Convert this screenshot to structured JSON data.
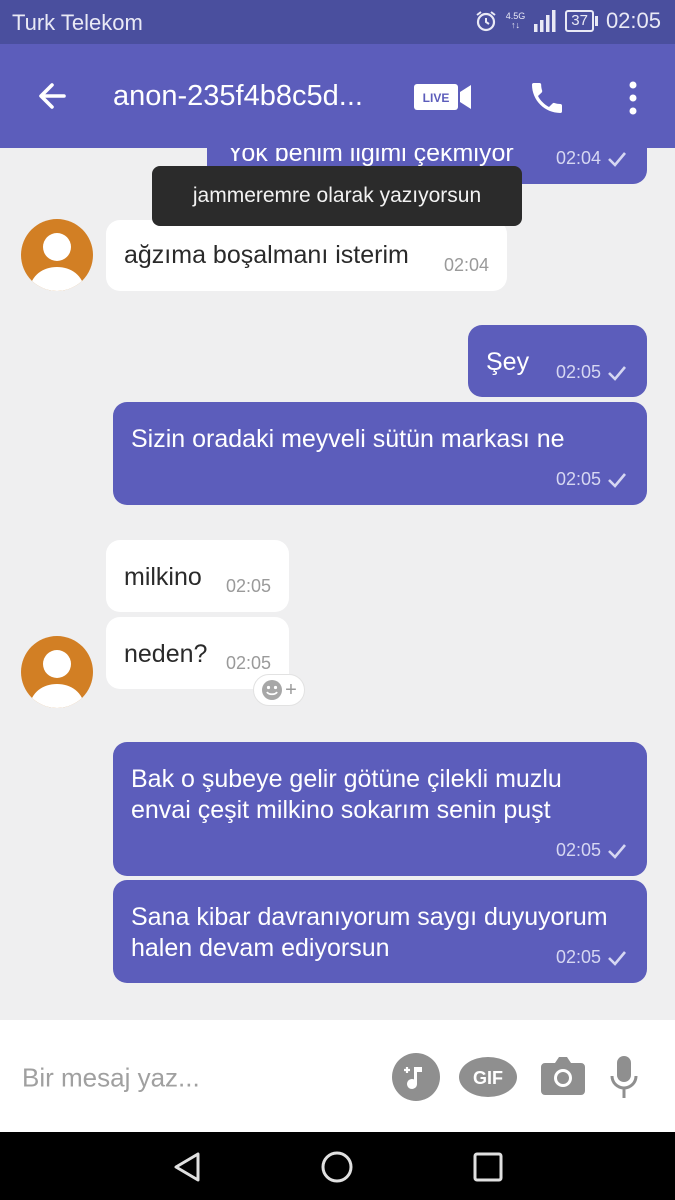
{
  "status_bar": {
    "carrier": "Turk Telekom",
    "network": "4.5G",
    "battery": "37",
    "time": "02:05"
  },
  "header": {
    "title": "anon-235f4b8c5d...",
    "live_label": "LIVE"
  },
  "messages": [
    {
      "direction": "out",
      "text": "Yok benim ilgimi çekmiyor",
      "time": "02:04"
    },
    {
      "direction": "in",
      "text": "ağzıma boşalmanı isterim",
      "time": "02:04"
    },
    {
      "direction": "out",
      "text": "Şey",
      "time": "02:05"
    },
    {
      "direction": "out",
      "text": "Sizin oradaki meyveli sütün markası ne",
      "time": "02:05"
    },
    {
      "direction": "in",
      "text": "milkino",
      "time": "02:05"
    },
    {
      "direction": "in",
      "text": "neden?",
      "time": "02:05"
    },
    {
      "direction": "out",
      "line1": "Bak o şubeye gelir götüne çilekli muzlu",
      "line2": "envai çeşit milkino sokarım senin puşt",
      "time": "02:05"
    },
    {
      "direction": "out",
      "line1": "Sana kibar davranıyorum saygı duyuyorum",
      "line2": "halen devam ediyorsun",
      "time": "02:05"
    }
  ],
  "toast": "jammeremre olarak yazıyorsun",
  "composer": {
    "placeholder": "Bir mesaj yaz...",
    "gif_label": "GIF"
  },
  "colors": {
    "status_bar": "#4a4f9e",
    "accent": "#5c5dbb",
    "avatar": "#d27f24",
    "background": "#efeff0"
  }
}
